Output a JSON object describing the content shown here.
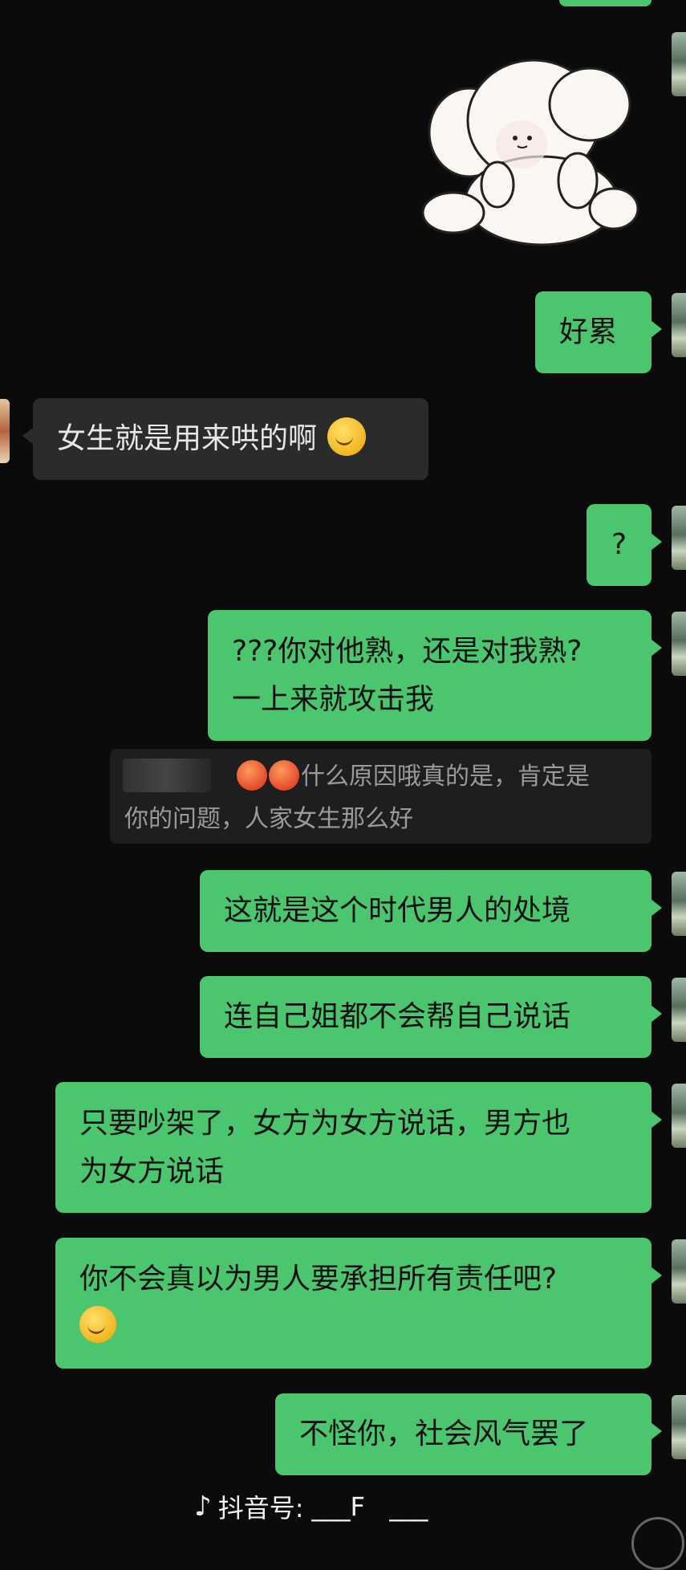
{
  "messages": [
    {
      "text": "好累"
    },
    {
      "text": "女生就是用来哄的啊"
    },
    {
      "text": "?"
    },
    {
      "line1": "???你对他熟，还是对我熟?",
      "line2": "一上来就攻击我"
    },
    {
      "text": "这就是这个时代男人的处境"
    },
    {
      "text": "连自己姐都不会帮自己说话"
    },
    {
      "line1": "只要吵架了，女方为女方说话，男方也",
      "line2": "为女方说话"
    },
    {
      "line1": "你不会真以为男人要承担所有责任吧?"
    },
    {
      "text": "不怪你，社会风气罢了"
    }
  ],
  "quote": {
    "line1": "什么原因哦真的是，肯定是",
    "line2": "你的问题，人家女生那么好"
  },
  "watermark": {
    "label": "抖音号:",
    "id": "___F   ___"
  },
  "icons": {
    "sticker": "bunny-sticker-icon",
    "emoji_sweat": "smile-sweat-emoji-icon",
    "emoji_angry": "angry-face-emoji-icon",
    "logo": "douyin-logo-icon"
  },
  "colors": {
    "background": "#0b0b0b",
    "sent_bubble": "#4cc66e",
    "received_bubble": "#2b2b2b"
  }
}
